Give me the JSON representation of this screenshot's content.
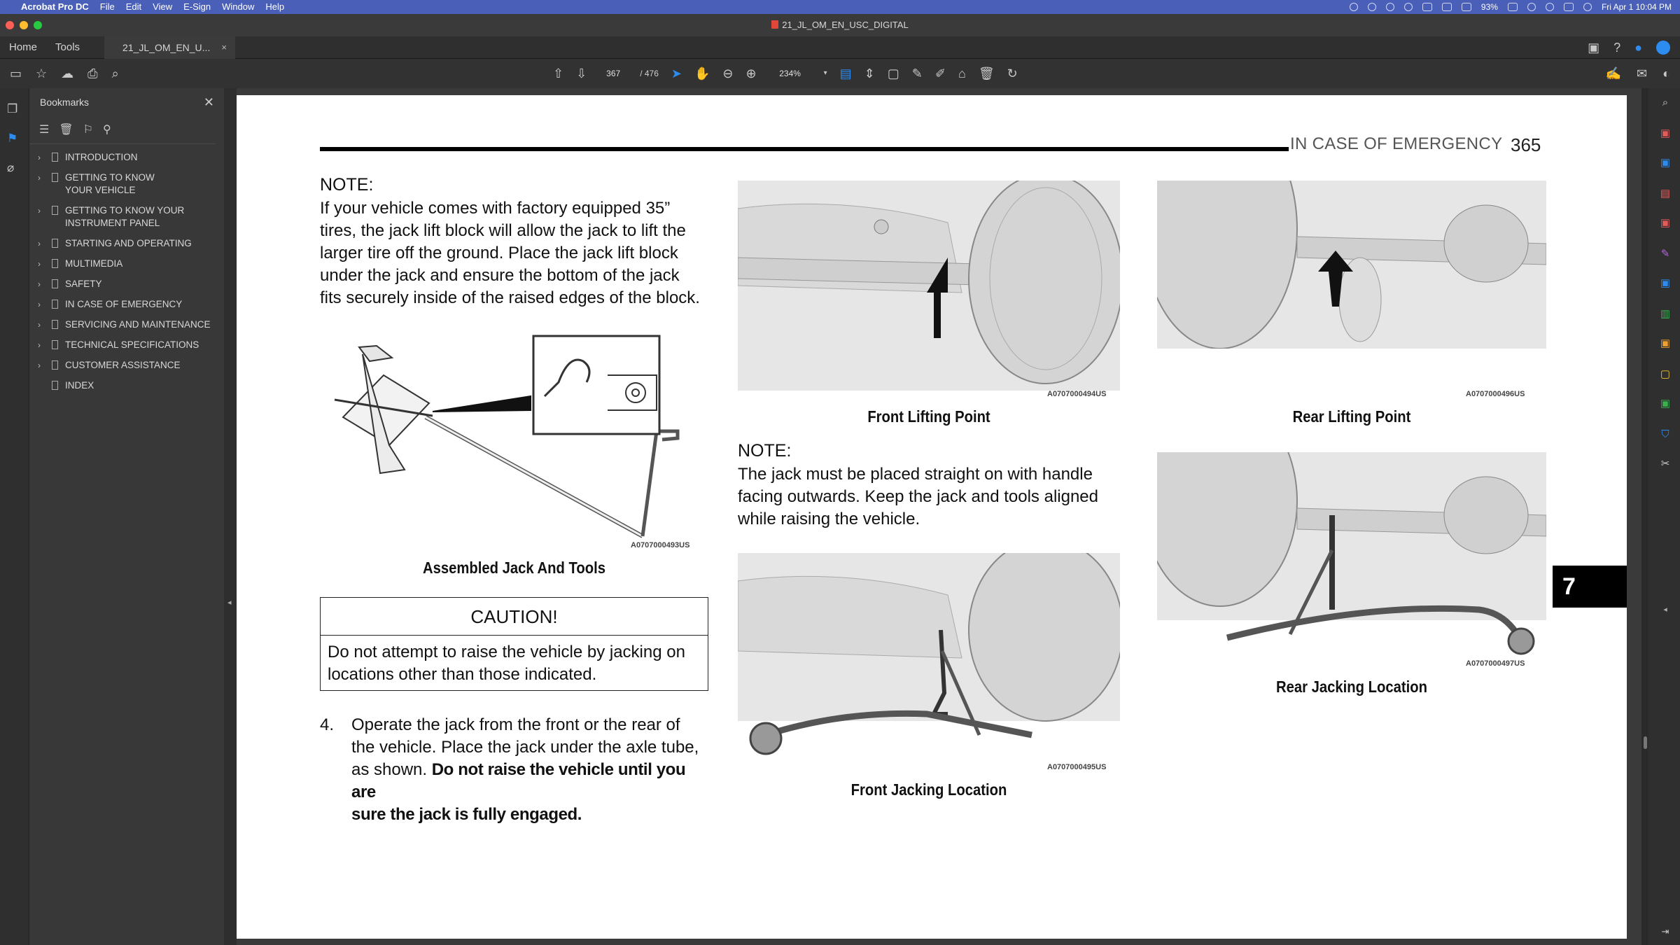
{
  "menubar": {
    "app_name": "Acrobat Pro DC",
    "menus": [
      "File",
      "Edit",
      "View",
      "E-Sign",
      "Window",
      "Help"
    ],
    "battery": "93%",
    "datetime": "Fri Apr 1  10:04 PM"
  },
  "window": {
    "doc_title": "21_JL_OM_EN_USC_DIGITAL"
  },
  "tabs": {
    "home": "Home",
    "tools": "Tools",
    "doc_tab": "21_JL_OM_EN_U...",
    "doc_tab_close": "×"
  },
  "toolbar": {
    "current_page": "367",
    "page_total": "/ 476",
    "zoom": "234%"
  },
  "bookmarks": {
    "title": "Bookmarks",
    "close": "✕",
    "items": [
      {
        "label": "INTRODUCTION",
        "has_children": true
      },
      {
        "label": "GETTING TO KNOW YOUR VEHICLE",
        "line1": "GETTING TO KNOW",
        "line2": "YOUR VEHICLE",
        "has_children": true
      },
      {
        "label": "GETTING TO KNOW YOUR INSTRUMENT PANEL",
        "line1": "GETTING TO KNOW YOUR",
        "line2": "INSTRUMENT PANEL",
        "has_children": true
      },
      {
        "label": "STARTING AND OPERATING",
        "has_children": true
      },
      {
        "label": "MULTIMEDIA",
        "has_children": true
      },
      {
        "label": "SAFETY",
        "has_children": true
      },
      {
        "label": "IN CASE OF EMERGENCY",
        "has_children": true
      },
      {
        "label": "SERVICING AND MAINTENANCE",
        "has_children": true
      },
      {
        "label": "TECHNICAL SPECIFICATIONS",
        "has_children": true
      },
      {
        "label": "CUSTOMER ASSISTANCE",
        "has_children": true
      },
      {
        "label": "INDEX",
        "has_children": false
      }
    ]
  },
  "page": {
    "section": "IN CASE OF EMERGENCY",
    "number": "365",
    "chapter_tab": "7",
    "note1_heading": "NOTE:",
    "note1_lines": [
      "If your vehicle comes with factory equipped 35”",
      "tires, the jack lift block will allow the jack to lift the",
      "larger tire off the ground. Place the jack lift block",
      "under the jack and ensure the bottom of the jack",
      "fits securely inside of the raised edges of the block."
    ],
    "fig_jack_code": "A0707000493US",
    "fig_jack_caption": "Assembled Jack And Tools",
    "caution_heading": "CAUTION!",
    "caution_lines": [
      "Do not attempt to raise the vehicle by jacking on",
      "locations other than those indicated."
    ],
    "step_number": "4.",
    "step_lines": [
      "Operate the jack from the front or the rear of",
      "the vehicle. Place the jack under the axle tube,"
    ],
    "step_line3_plain": "as shown. ",
    "step_line3_bold": "Do not raise the vehicle until you are",
    "step_line4_bold": "sure the jack is fully engaged.",
    "fig_front_lift_code": "A0707000494US",
    "fig_front_lift_caption": "Front Lifting Point",
    "fig_rear_lift_code": "A0707000496US",
    "fig_rear_lift_caption": "Rear Lifting Point",
    "note2_heading": "NOTE:",
    "note2_lines": [
      "The jack must be placed straight on with handle",
      "facing outwards. Keep the jack and tools aligned",
      "while raising the vehicle."
    ],
    "fig_front_jack_code": "A0707000495US",
    "fig_front_jack_caption": "Front Jacking Location",
    "fig_rear_jack_code": "A0707000497US",
    "fig_rear_jack_caption": "Rear Jacking Location"
  },
  "colors": {
    "menubar": "#4a5fb8",
    "accent_blue": "#2c8cf0",
    "page_bg": "#ffffff",
    "app_bg": "#323232"
  }
}
